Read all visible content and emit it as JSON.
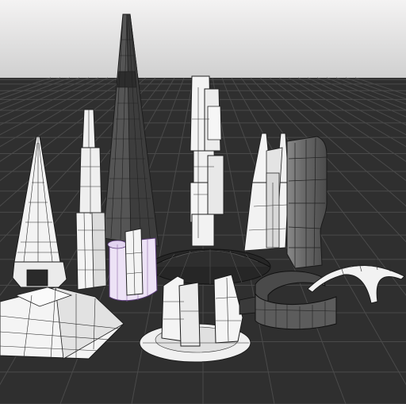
{
  "viewport": {
    "sky_color_top": "#dcdcdc",
    "sky_color_bottom": "#bdbdbd",
    "ground_color": "#2e2e2e",
    "grid_color": "#4a4a4a",
    "wire_color": "#222222",
    "white_fill": "#f2f2f2",
    "dark_fill": "#5a5a5a",
    "selected_fill": "#e6d8f2"
  },
  "objects": [
    "needle-tower",
    "spire-tower",
    "dark-obelisk",
    "tall-slab-tower",
    "twin-prong-tower",
    "dark-curved-monolith",
    "selected-cylinder",
    "dome-disc",
    "broken-ring-ruin",
    "dark-ring",
    "arched-canopy",
    "stepped-pyramid"
  ]
}
